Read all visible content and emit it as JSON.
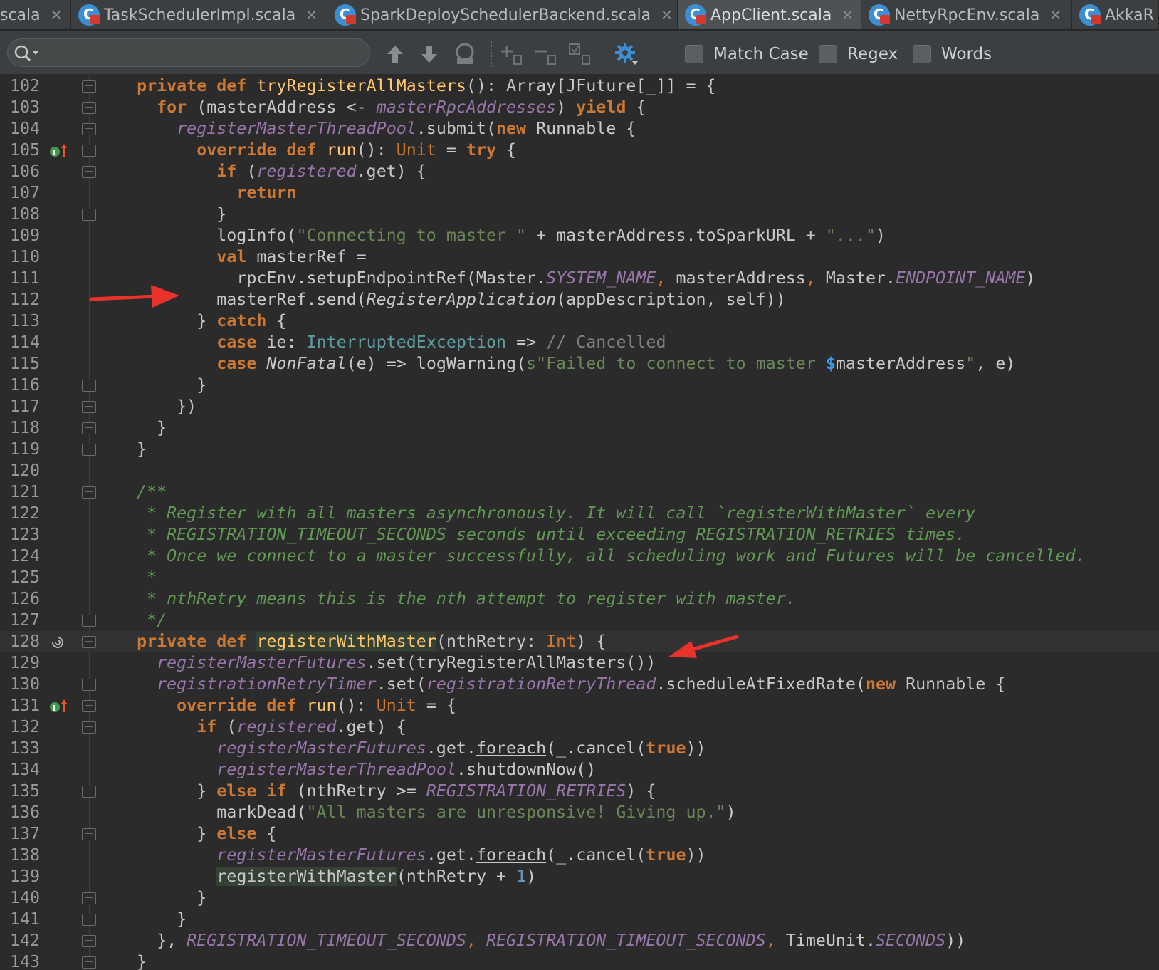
{
  "tabs": [
    {
      "label": "scala",
      "active": false
    },
    {
      "label": "TaskSchedulerImpl.scala",
      "active": false
    },
    {
      "label": "SparkDeploySchedulerBackend.scala",
      "active": false
    },
    {
      "label": "AppClient.scala",
      "active": true
    },
    {
      "label": "NettyRpcEnv.scala",
      "active": false
    },
    {
      "label": "AkkaR",
      "active": false
    }
  ],
  "search": {
    "value": "",
    "match_case_label": "Match Case",
    "regex_label": "Regex",
    "words_label": "Words"
  },
  "colors": {
    "keyword": "#cc7832",
    "function": "#ffc66d",
    "instance_var": "#9876aa",
    "string": "#6a8759",
    "doc_comment": "#629755",
    "annotation_arrow": "#e8322b"
  },
  "editor": {
    "line_numbers": [
      "102",
      "103",
      "104",
      "105",
      "106",
      "107",
      "108",
      "109",
      "110",
      "111",
      "112",
      "113",
      "114",
      "115",
      "116",
      "117",
      "118",
      "119",
      "120",
      "121",
      "122",
      "123",
      "124",
      "125",
      "126",
      "127",
      "128",
      "129",
      "130",
      "131",
      "132",
      "133",
      "134",
      "135",
      "136",
      "137",
      "138",
      "139",
      "140",
      "141",
      "142",
      "143"
    ],
    "lines": {
      "l102": [
        "  ",
        "private def ",
        "tryRegisterAllMasters",
        "(): Array[JFuture[_]] = {"
      ],
      "l103": [
        "    ",
        "for ",
        "(masterAddress <- ",
        "masterRpcAddresses",
        ") ",
        "yield ",
        "{"
      ],
      "l104": [
        "      ",
        "registerMasterThreadPool",
        ".submit(",
        "new ",
        "Runnable {"
      ],
      "l105": [
        "        ",
        "override def ",
        "run",
        "(): ",
        "Unit",
        " = ",
        "try ",
        "{"
      ],
      "l106": [
        "          ",
        "if ",
        "(",
        "registered",
        ".get) {"
      ],
      "l107": [
        "            ",
        "return"
      ],
      "l108": [
        "          }"
      ],
      "l109": [
        "          logInfo(",
        "\"Connecting to master \"",
        " + masterAddress.toSparkURL + ",
        "\"...\"",
        ")"
      ],
      "l110": [
        "          ",
        "val ",
        "masterRef ="
      ],
      "l111": [
        "            rpcEnv.setupEndpointRef(Master.",
        "SYSTEM_NAME",
        ", ",
        "masterAddress",
        ", ",
        "Master.",
        "ENDPOINT_NAME",
        ")"
      ],
      "l112": [
        "          masterRef.send(",
        "RegisterApplication",
        "(appDescription, self))"
      ],
      "l113": [
        "        } ",
        "catch ",
        "{"
      ],
      "l114": [
        "          ",
        "case ",
        "ie: ",
        "InterruptedException",
        " => ",
        "// Cancelled"
      ],
      "l115": [
        "          ",
        "case ",
        "NonFatal",
        "(e) => logWarning(",
        "s\"Failed to connect to master ",
        "$",
        "masterAddress",
        "\"",
        ", e)"
      ],
      "l116": [
        "        }"
      ],
      "l117": [
        "      })"
      ],
      "l118": [
        "    }"
      ],
      "l119": [
        "  }"
      ],
      "l120": [
        ""
      ],
      "l121": [
        "  /**"
      ],
      "l122": [
        "   * Register with all masters asynchronously. It will call `registerWithMaster` every"
      ],
      "l123": [
        "   * REGISTRATION_TIMEOUT_SECONDS seconds until exceeding REGISTRATION_RETRIES times."
      ],
      "l124": [
        "   * Once we connect to a master successfully, all scheduling work and Futures will be cancelled."
      ],
      "l125": [
        "   *"
      ],
      "l126": [
        "   * nthRetry means this is the nth attempt to register with master."
      ],
      "l127": [
        "   */"
      ],
      "l128": [
        "  ",
        "private def ",
        "registerWithMaster",
        "(nthRetry: ",
        "Int",
        ") {"
      ],
      "l129": [
        "    ",
        "registerMasterFutures",
        ".set(tryRegisterAllMasters())"
      ],
      "l130": [
        "    ",
        "registrationRetryTimer",
        ".set(",
        "registrationRetryThread",
        ".scheduleAtFixedRate(",
        "new ",
        "Runnable {"
      ],
      "l131": [
        "      ",
        "override def ",
        "run",
        "(): ",
        "Unit",
        " = {"
      ],
      "l132": [
        "        ",
        "if ",
        "(",
        "registered",
        ".get) {"
      ],
      "l133": [
        "          ",
        "registerMasterFutures",
        ".get.",
        "foreach",
        "(_.cancel(",
        "true",
        "))"
      ],
      "l134": [
        "          ",
        "registerMasterThreadPool",
        ".shutdownNow()"
      ],
      "l135": [
        "        } ",
        "else if ",
        "(nthRetry >= ",
        "REGISTRATION_RETRIES",
        ") {"
      ],
      "l136": [
        "          markDead(",
        "\"All masters are unresponsive! Giving up.\"",
        ")"
      ],
      "l137": [
        "        } ",
        "else ",
        "{"
      ],
      "l138": [
        "          ",
        "registerMasterFutures",
        ".get.",
        "foreach",
        "(_.cancel(",
        "true",
        "))"
      ],
      "l139": [
        "          ",
        "registerWithMaster",
        "(nthRetry + ",
        "1",
        ")"
      ],
      "l140": [
        "        }"
      ],
      "l141": [
        "      }"
      ],
      "l142": [
        "    }, ",
        "REGISTRATION_TIMEOUT_SECONDS",
        ", ",
        "REGISTRATION_TIMEOUT_SECONDS",
        ", ",
        "TimeUnit.",
        "SECONDS",
        "))"
      ],
      "l143": [
        "  }"
      ]
    }
  }
}
